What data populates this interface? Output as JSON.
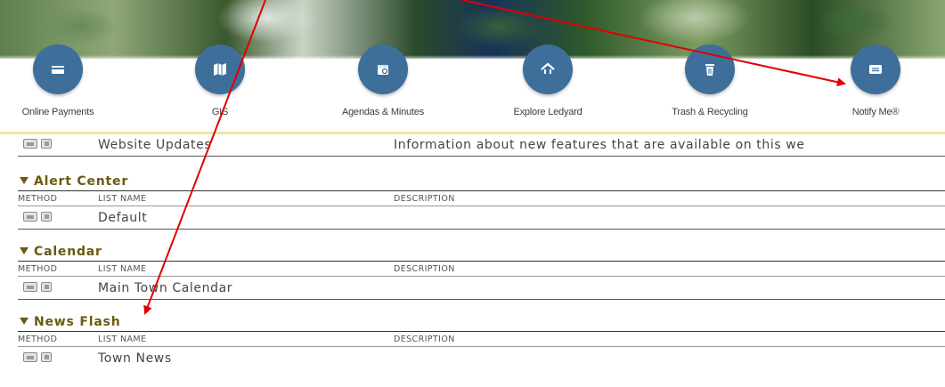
{
  "quick_links": [
    {
      "label": "Online Payments",
      "icon": "credit-card-icon"
    },
    {
      "label": "GIS",
      "icon": "map-icon"
    },
    {
      "label": "Agendas & Minutes",
      "icon": "calendar-icon"
    },
    {
      "label": "Explore Ledyard",
      "icon": "home-icon"
    },
    {
      "label": "Trash & Recycling",
      "icon": "trash-icon"
    },
    {
      "label": "Notify Me®",
      "icon": "envelope-icon"
    }
  ],
  "top_row": {
    "name": "Website Updates",
    "description": "Information about new features that are available on this we"
  },
  "columns": {
    "method": "METHOD",
    "list_name": "LIST NAME",
    "description": "DESCRIPTION"
  },
  "sections": [
    {
      "title": "Alert Center",
      "rows": [
        {
          "name": "Default",
          "description": ""
        }
      ]
    },
    {
      "title": "Calendar",
      "rows": [
        {
          "name": "Main Town Calendar",
          "description": ""
        }
      ]
    },
    {
      "title": "News Flash",
      "rows": [
        {
          "name": "Town News",
          "description": ""
        }
      ]
    }
  ],
  "colors": {
    "icon_circle": "#3e6f9a",
    "section_title": "#6b5a10",
    "annotation_arrow": "#e00000",
    "gold_divider": "#f1e3a0"
  }
}
